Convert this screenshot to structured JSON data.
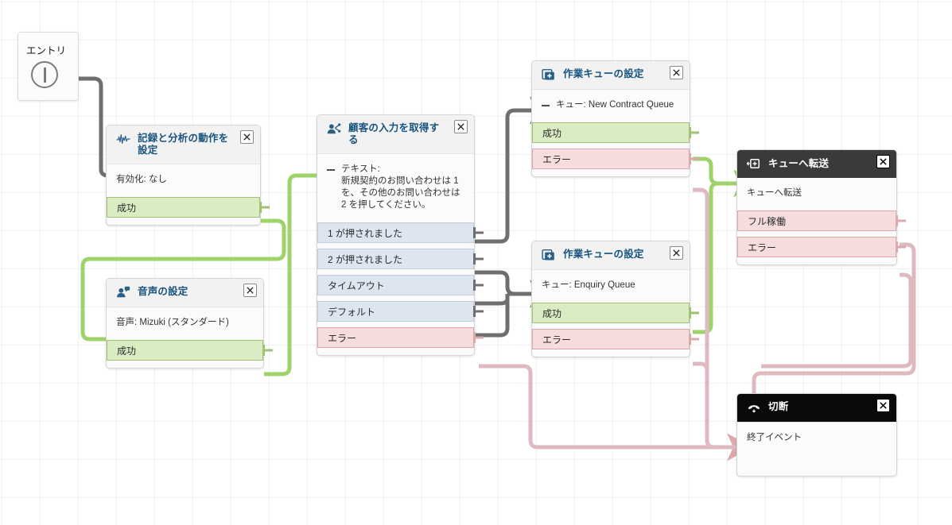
{
  "canvas": {
    "entry": {
      "label": "エントリ",
      "icon": "entry-circle-icon"
    },
    "colors": {
      "success_fill": "#d9ecc2",
      "success_border": "#9ec26f",
      "error_fill": "#f6dcdc",
      "error_border": "#dba8ac",
      "neutral_fill": "#dde5f0",
      "neutral_border": "#c2ccda",
      "title_blue": "#16537e",
      "wire_gray": "#6f6f6f",
      "wire_green": "#9ed36a",
      "wire_pink": "#debac0",
      "header_dark": "#3a3a3a",
      "header_black": "#0a0a0a"
    },
    "nodes": [
      {
        "id": "set-logging",
        "title": "記録と分析の動作を設定",
        "icon": "waveform-icon",
        "close_label": "×",
        "body": [
          {
            "has_minus": false,
            "text": "有効化: なし"
          }
        ],
        "ports": [
          {
            "label": "成功",
            "kind": "ok"
          }
        ]
      },
      {
        "id": "set-voice",
        "title": "音声の設定",
        "icon": "voice-person-icon",
        "close_label": "×",
        "body": [
          {
            "has_minus": false,
            "text": "音声: Mizuki (スタンダード)"
          }
        ],
        "ports": [
          {
            "label": "成功",
            "kind": "ok"
          }
        ]
      },
      {
        "id": "get-customer-input",
        "title": "顧客の入力を取得する",
        "icon": "customer-input-icon",
        "close_label": "×",
        "body": [
          {
            "has_minus": true,
            "text": "テキスト:\n新規契約のお問い合わせは 1 を、その他のお問い合わせは 2 を押してください。"
          }
        ],
        "ports": [
          {
            "label": "1 が押されました",
            "kind": "neutral"
          },
          {
            "label": "2 が押されました",
            "kind": "neutral"
          },
          {
            "label": "タイムアウト",
            "kind": "neutral"
          },
          {
            "label": "デフォルト",
            "kind": "neutral"
          },
          {
            "label": "エラー",
            "kind": "err"
          }
        ]
      },
      {
        "id": "set-working-queue-new-contract",
        "title": "作業キューの設定",
        "icon": "queue-add-icon",
        "close_label": "×",
        "body": [
          {
            "has_minus": true,
            "text": "キュー: New Contract Queue"
          }
        ],
        "ports": [
          {
            "label": "成功",
            "kind": "ok"
          },
          {
            "label": "エラー",
            "kind": "err"
          }
        ]
      },
      {
        "id": "set-working-queue-enquiry",
        "title": "作業キューの設定",
        "icon": "queue-add-icon",
        "close_label": "×",
        "body": [
          {
            "has_minus": false,
            "text": "キュー: Enquiry Queue"
          }
        ],
        "ports": [
          {
            "label": "成功",
            "kind": "ok"
          },
          {
            "label": "エラー",
            "kind": "err"
          }
        ]
      },
      {
        "id": "transfer-to-queue",
        "title": "キューへ転送",
        "icon": "transfer-queue-icon",
        "close_label": "×",
        "body": [
          {
            "has_minus": false,
            "text": "キューへ転送"
          }
        ],
        "ports": [
          {
            "label": "フル稼働",
            "kind": "err"
          },
          {
            "label": "エラー",
            "kind": "err"
          }
        ]
      },
      {
        "id": "disconnect",
        "title": "切断",
        "icon": "hangup-phone-icon",
        "close_label": "×",
        "body": [
          {
            "has_minus": false,
            "text": "終了イベント"
          }
        ],
        "ports": []
      }
    ]
  }
}
